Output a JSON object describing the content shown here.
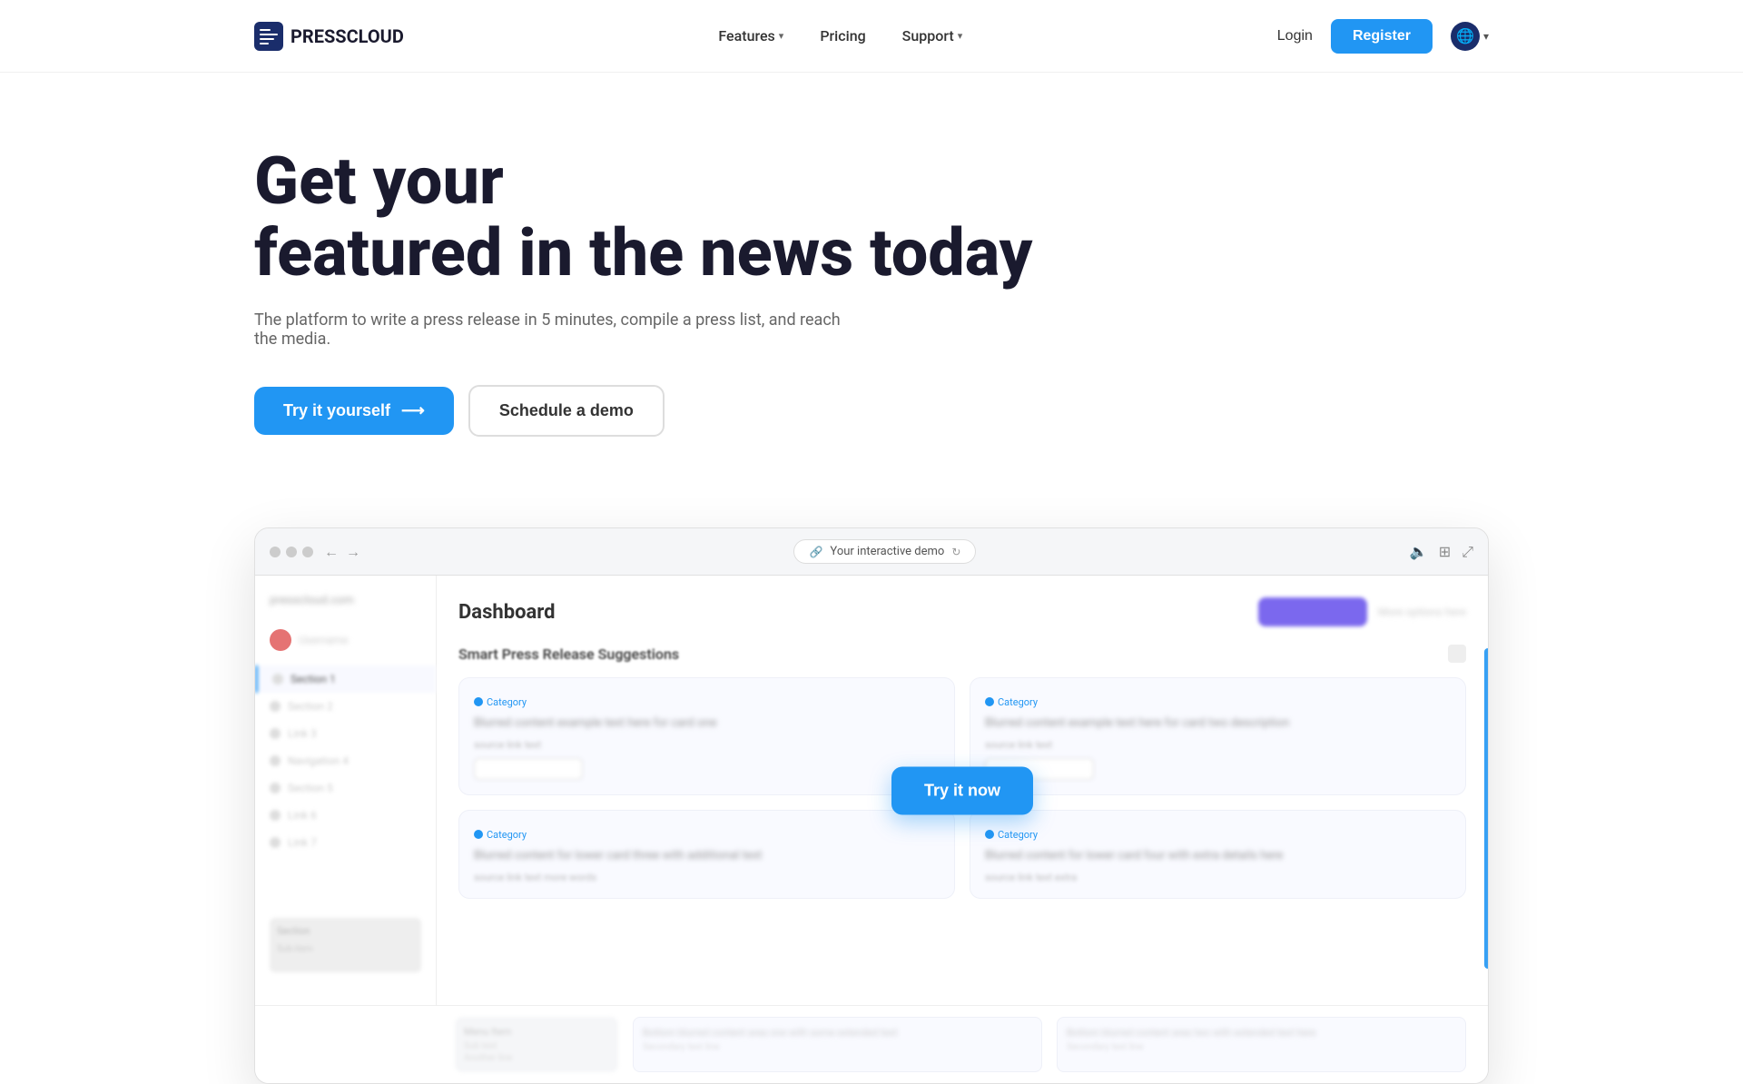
{
  "brand": {
    "name": "PRESSCLOUD",
    "logo_alt": "PressCloud logo"
  },
  "navbar": {
    "features_label": "Features",
    "pricing_label": "Pricing",
    "support_label": "Support",
    "login_label": "Login",
    "register_label": "Register",
    "lang_label": "🌐"
  },
  "hero": {
    "title_line1": "Get your",
    "title_line2": "featured in the news today",
    "subtitle": "The platform to write a press release in 5 minutes, compile a press list, and reach the media.",
    "cta_primary": "Try it yourself",
    "cta_arrow": "⟶",
    "cta_secondary": "Schedule a demo"
  },
  "demo": {
    "browser_url_label": "Your interactive demo",
    "dashboard_title": "Dashboard",
    "section_title": "Smart Press Release Suggestions",
    "try_now_label": "Try it now",
    "card1_text": "Blurred content example text here for card one",
    "card2_text": "Blurred content example text here for card two description",
    "card3_text": "Blurred content for lower card three with additional text",
    "card4_text": "Blurred content for lower card four with extra details here"
  },
  "sidebar": {
    "items": [
      {
        "label": "Section 1"
      },
      {
        "label": "Section 2"
      },
      {
        "label": "Link 3"
      },
      {
        "label": "Navigation 4"
      },
      {
        "label": "Section 5"
      },
      {
        "label": "Link 6"
      },
      {
        "label": "Link 7"
      }
    ]
  }
}
